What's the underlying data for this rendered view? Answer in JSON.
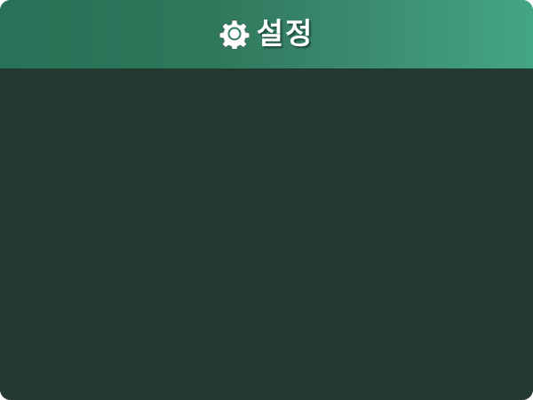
{
  "header": {
    "icon": "gear-icon",
    "title": "설정"
  },
  "colors": {
    "header_gradient_start": "#2a7257",
    "header_gradient_end": "#44a682",
    "panel_background": "#243930",
    "title_text": "#ffffff"
  }
}
